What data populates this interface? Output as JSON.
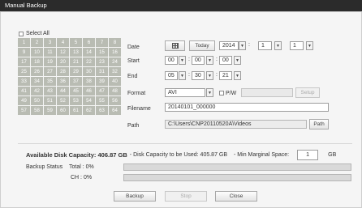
{
  "window": {
    "title": "Manual Backup"
  },
  "channels": {
    "select_all_label": "Select All",
    "items": [
      "1",
      "2",
      "3",
      "4",
      "5",
      "6",
      "7",
      "8",
      "9",
      "10",
      "11",
      "12",
      "13",
      "14",
      "15",
      "16",
      "17",
      "18",
      "19",
      "20",
      "21",
      "22",
      "23",
      "24",
      "25",
      "26",
      "27",
      "28",
      "29",
      "30",
      "31",
      "32",
      "33",
      "34",
      "35",
      "36",
      "37",
      "38",
      "39",
      "40",
      "41",
      "42",
      "43",
      "44",
      "45",
      "46",
      "47",
      "48",
      "49",
      "50",
      "51",
      "52",
      "53",
      "54",
      "55",
      "56",
      "57",
      "58",
      "59",
      "60",
      "61",
      "62",
      "63",
      "64"
    ]
  },
  "form": {
    "date_label": "Date",
    "today_label": "Today",
    "year": "2014",
    "month": "1",
    "day": "1",
    "start_label": "Start",
    "start_h": "00",
    "start_m": "00",
    "start_s": "00",
    "end_label": "End",
    "end_h": "05",
    "end_m": "30",
    "end_s": "21",
    "format_label": "Format",
    "format_value": "AVI",
    "pw_label": "P/W",
    "setup_label": "Setup",
    "filename_label": "Filename",
    "filename_value": "20140101_000000",
    "path_label": "Path",
    "path_value": "C:\\Users\\CNP20110520A\\Videos",
    "path_button": "Path",
    "dropdown_arrow": "▼",
    "colon": ":"
  },
  "disk": {
    "available": "Available Disk Capacity: 406.87 GB",
    "to_be_used": "- Disk Capacity to be Used: 405.87 GB",
    "min_marginal": "- Min Marginal Space:",
    "min_value": "1",
    "unit": "GB"
  },
  "status": {
    "label": "Backup Status",
    "total": "Total : 0%",
    "ch": "CH : 0%",
    "total_progress": 0,
    "ch_progress": 0
  },
  "buttons": {
    "backup": "Backup",
    "stop": "Stop",
    "close": "Close"
  }
}
